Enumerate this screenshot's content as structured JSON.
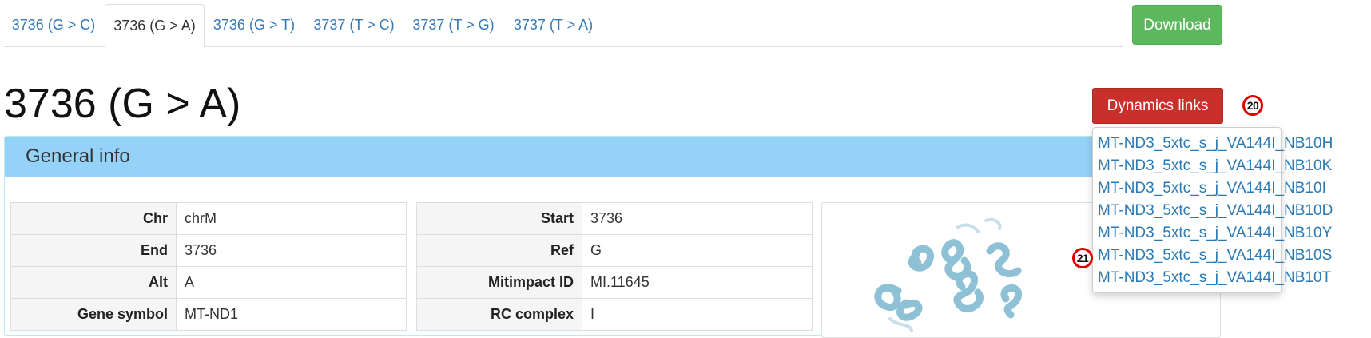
{
  "tabs": [
    {
      "label": "3736 (G > C)",
      "active": false
    },
    {
      "label": "3736 (G > A)",
      "active": true
    },
    {
      "label": "3736 (G > T)",
      "active": false
    },
    {
      "label": "3737 (T > C)",
      "active": false
    },
    {
      "label": "3737 (T > G)",
      "active": false
    },
    {
      "label": "3737 (T > A)",
      "active": false
    }
  ],
  "download_label": "Download",
  "page_title": "3736 (G > A)",
  "dynamics_button_label": "Dynamics links",
  "markers": [
    "20",
    "21"
  ],
  "panel_title": "General info",
  "left_table": [
    {
      "key": "Chr",
      "value": "chrM"
    },
    {
      "key": "End",
      "value": "3736"
    },
    {
      "key": "Alt",
      "value": "A"
    },
    {
      "key": "Gene symbol",
      "value": "MT-ND1"
    }
  ],
  "middle_table": [
    {
      "key": "Start",
      "value": "3736"
    },
    {
      "key": "Ref",
      "value": "G"
    },
    {
      "key": "Mitimpact ID",
      "value": "MI.11645"
    },
    {
      "key": "RC complex",
      "value": "I"
    }
  ],
  "dynamics_links": [
    "MT-ND3_5xtc_s_j_VA144I_NB10H",
    "MT-ND3_5xtc_s_j_VA144I_NB10K",
    "MT-ND3_5xtc_s_j_VA144I_NB10I",
    "MT-ND3_5xtc_s_j_VA144I_NB10D",
    "MT-ND3_5xtc_s_j_VA144I_NB10Y",
    "MT-ND3_5xtc_s_j_VA144I_NB10S",
    "MT-ND3_5xtc_s_j_VA144I_NB10T"
  ],
  "colors": {
    "link": "#337ab7",
    "download": "#5cb85c",
    "dynamics": "#c9302c",
    "panel_heading": "#94d2f8",
    "ribbon": "#9cc8dc"
  },
  "icons": {
    "structure": "protein-ribbon-structure-image"
  }
}
